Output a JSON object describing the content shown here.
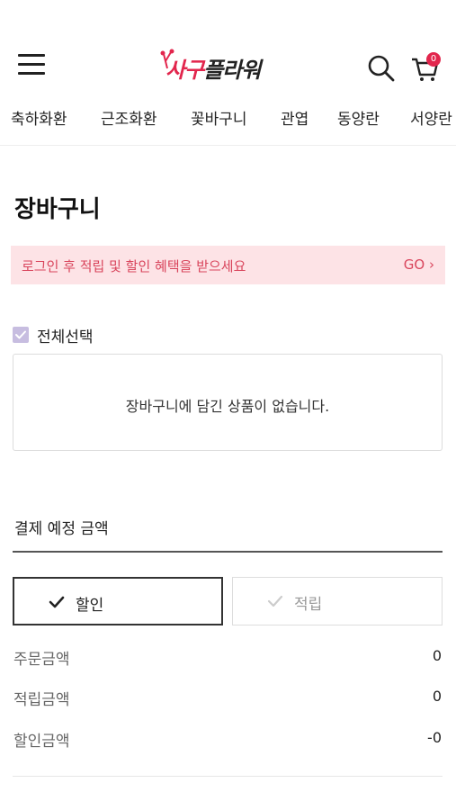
{
  "header": {
    "logo": {
      "text_part1": "사구",
      "text_part2": "플라워"
    },
    "cart_count": "0"
  },
  "nav": {
    "items": [
      "축하화환",
      "근조화환",
      "꽃바구니",
      "관엽",
      "동양란",
      "서양란"
    ]
  },
  "page": {
    "title": "장바구니"
  },
  "login_banner": {
    "text": "로그인 후 적립 및 할인 혜택을 받으세요",
    "go_label": "GO ›"
  },
  "cart": {
    "select_all_label": "전체선택",
    "select_all_checked": true,
    "empty_message": "장바구니에 담긴 상품이 없습니다."
  },
  "payment": {
    "title": "결제 예정 금액",
    "tabs": [
      {
        "label": "할인",
        "selected": true
      },
      {
        "label": "적립",
        "selected": false
      }
    ],
    "rows": [
      {
        "label": "주문금액",
        "value": "0"
      },
      {
        "label": "적립금액",
        "value": "0"
      },
      {
        "label": "할인금액",
        "value": "-0"
      }
    ]
  },
  "colors": {
    "brand": "#e2264d",
    "banner_bg": "#fde3e6",
    "banner_text": "#d9455c",
    "checkbox": "#c7bde0"
  }
}
